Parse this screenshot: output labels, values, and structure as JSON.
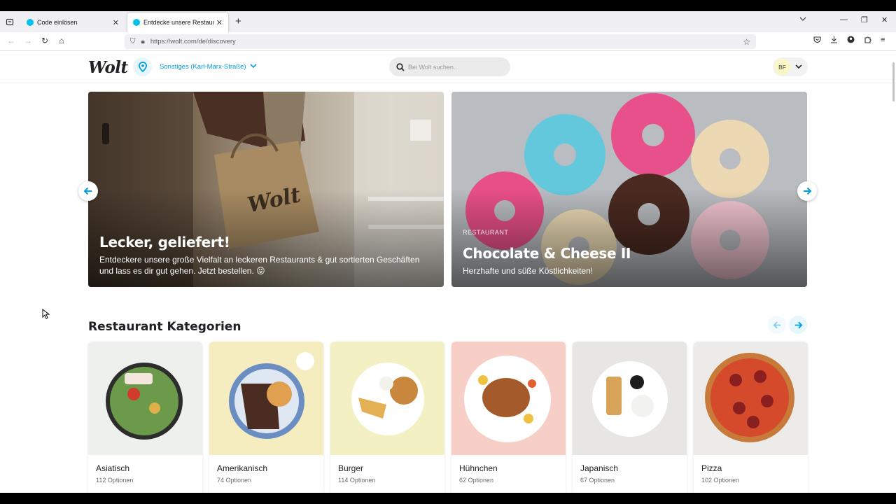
{
  "browser": {
    "tabs": [
      {
        "title": "Code einlösen",
        "active": false
      },
      {
        "title": "Entdecke unsere Restaurants, S...",
        "active": true
      }
    ],
    "url": "https://wolt.com/de/discovery"
  },
  "header": {
    "logo": "Wolt",
    "location": "Sonstiges (Karl-Marx-Straße)",
    "search_placeholder": "Bei Wolt suchen...",
    "avatar_initials": "BF"
  },
  "banners": [
    {
      "kicker": "",
      "title": "Lecker, geliefert!",
      "subtitle": "Entdeckere unsere große Vielfalt an leckeren Restaurants & gut sortierten Geschäften und lass es dir gut gehen. Jetzt bestellen. 😝"
    },
    {
      "kicker": "RESTAURANT",
      "title": "Chocolate & Cheese II",
      "subtitle": "Herzhafte und süße Köstlichkeiten!"
    }
  ],
  "categories": {
    "heading": "Restaurant Kategorien",
    "items": [
      {
        "name": "Asiatisch",
        "count": "112 Optionen",
        "bg": "#eef0ee"
      },
      {
        "name": "Amerikanisch",
        "count": "74 Optionen",
        "bg": "#f5ecc0"
      },
      {
        "name": "Burger",
        "count": "114 Optionen",
        "bg": "#f3f0c4"
      },
      {
        "name": "Hühnchen",
        "count": "62 Optionen",
        "bg": "#f8cfc6"
      },
      {
        "name": "Japanisch",
        "count": "67 Optionen",
        "bg": "#e7e6e2"
      },
      {
        "name": "Pizza",
        "count": "102 Optionen",
        "bg": "#ecebea"
      }
    ]
  },
  "colors": {
    "accent": "#009de0",
    "accent_bg": "#e6f7fc",
    "text": "#202125"
  }
}
